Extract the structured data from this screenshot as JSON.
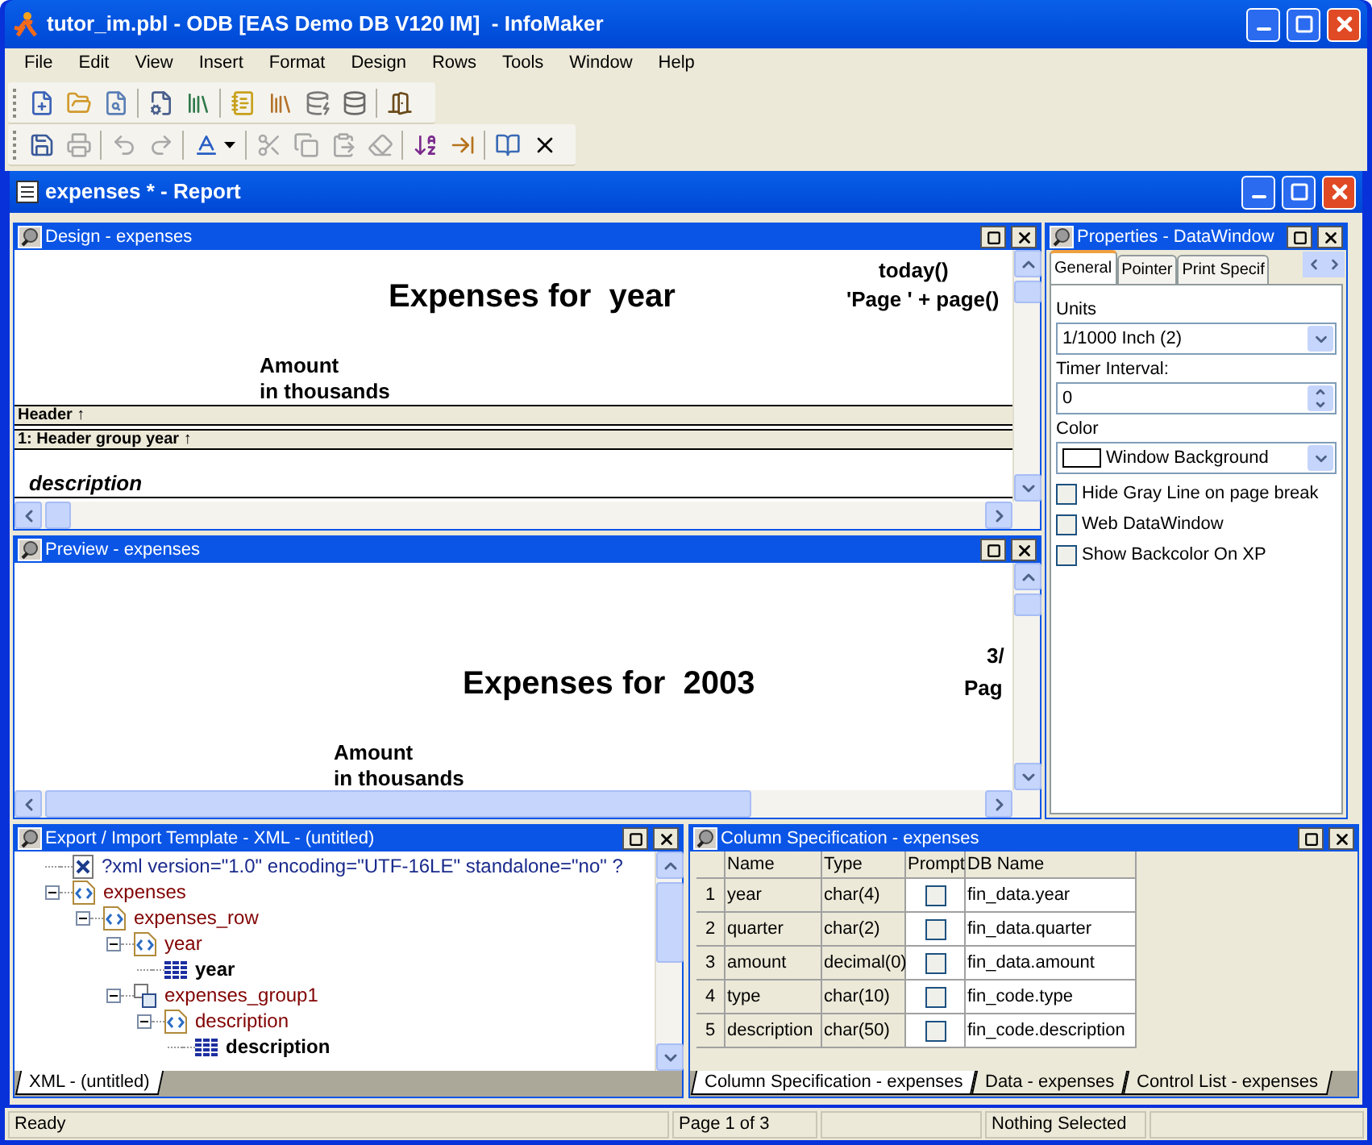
{
  "window": {
    "title": "tutor_im.pbl - ODB [EAS Demo DB V120 IM]  - InfoMaker"
  },
  "menu": [
    "File",
    "Edit",
    "View",
    "Insert",
    "Format",
    "Design",
    "Rows",
    "Tools",
    "Window",
    "Help"
  ],
  "report_window": {
    "title": "expenses * - Report"
  },
  "design_pane": {
    "title": "Design - expenses",
    "date_field": "today()",
    "report_title": "Expenses for  year",
    "page_field": "'Page ' + page()",
    "column_heading": [
      "Amount",
      "in thousands"
    ],
    "bands": [
      "Header ↑",
      "1: Header group year ↑"
    ],
    "group_field": "description"
  },
  "preview_pane": {
    "title": "Preview - expenses",
    "date_field": "3/",
    "report_title": "Expenses for  2003",
    "page_field": "Pag",
    "column_heading": [
      "Amount",
      "in thousands"
    ]
  },
  "properties": {
    "title": "Properties -  DataWindow",
    "tabs": [
      {
        "label": "General",
        "selected": true
      },
      {
        "label": "Pointer",
        "selected": false
      },
      {
        "label": "Print Specif",
        "selected": false
      }
    ],
    "fields": [
      {
        "kind": "dropdown",
        "label": "Units",
        "value": "1/1000 Inch (2)"
      },
      {
        "kind": "spinner",
        "label": "Timer Interval:",
        "value": "0"
      },
      {
        "kind": "color",
        "label": "Color",
        "value": "Window Background"
      }
    ],
    "checkboxes": [
      {
        "label": "Hide Gray Line on page break",
        "checked": false
      },
      {
        "label": "Web DataWindow",
        "checked": false
      },
      {
        "label": "Show Backcolor On XP",
        "checked": false
      }
    ]
  },
  "xml_template": {
    "title": "Export / Import Template - XML - (untitled)",
    "tree": [
      {
        "kind": "declaration",
        "label": "?xml version=\"1.0\" encoding=\"UTF-16LE\" standalone=\"no\" ?"
      },
      {
        "kind": "element",
        "label": "expenses",
        "expanded": true,
        "children": [
          {
            "kind": "element",
            "label": "expenses_row",
            "expanded": true,
            "children": [
              {
                "kind": "element",
                "label": "year",
                "expanded": true,
                "children": [
                  {
                    "kind": "column",
                    "label": "year"
                  }
                ]
              },
              {
                "kind": "group",
                "label": "expenses_group1",
                "expanded": true,
                "children": [
                  {
                    "kind": "element",
                    "label": "description",
                    "expanded": true,
                    "children": [
                      {
                        "kind": "column",
                        "label": "description"
                      }
                    ]
                  }
                ]
              }
            ]
          }
        ]
      }
    ],
    "tabs": [
      {
        "label": "XML - (untitled)",
        "selected": true
      }
    ]
  },
  "column_spec": {
    "title": "Column Specification - expenses",
    "columns": [
      "Name",
      "Type",
      "Prompt",
      "DB Name"
    ],
    "rows": [
      {
        "number": "1",
        "name": "year",
        "type": "char(4)",
        "prompt": false,
        "db_name": "fin_data.year"
      },
      {
        "number": "2",
        "name": "quarter",
        "type": "char(2)",
        "prompt": false,
        "db_name": "fin_data.quarter"
      },
      {
        "number": "3",
        "name": "amount",
        "type": "decimal(0)",
        "prompt": false,
        "db_name": "fin_data.amount"
      },
      {
        "number": "4",
        "name": "type",
        "type": "char(10)",
        "prompt": false,
        "db_name": "fin_code.type"
      },
      {
        "number": "5",
        "name": "description",
        "type": "char(50)",
        "prompt": false,
        "db_name": "fin_code.description"
      }
    ],
    "tabs": [
      {
        "label": "Column Specification - expenses",
        "selected": true
      },
      {
        "label": "Data - expenses",
        "selected": false
      },
      {
        "label": "Control List - expenses",
        "selected": false
      }
    ]
  },
  "status_bar": {
    "message": "Ready",
    "page": "Page 1 of 3",
    "selection": "Nothing Selected"
  }
}
